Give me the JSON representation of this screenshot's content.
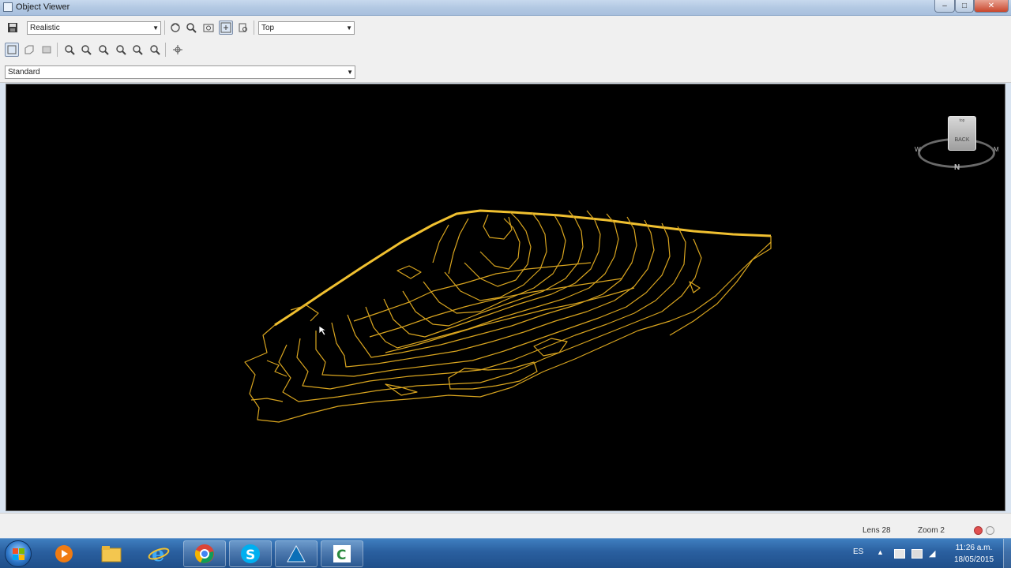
{
  "window": {
    "title": "Object Viewer"
  },
  "toolbar": {
    "visual_style": "Realistic",
    "view_direction": "Top",
    "display_style": "Standard",
    "icons_row1": [
      "save-icon",
      "orbit-icon",
      "zoom-icon",
      "zoom-window-icon",
      "pan-icon",
      "extents-icon"
    ],
    "icons_row2": [
      "view-top-icon",
      "view-iso-icon",
      "view-render-icon",
      "zoom-in-icon",
      "zoom-out-icon",
      "zoom-center-icon",
      "zoom-previous-icon",
      "zoom-all-icon",
      "zoom-extents-icon",
      "crosshair-icon"
    ]
  },
  "viewcube": {
    "face_label": "BACK",
    "top_label": "top",
    "north": "N",
    "west": "W",
    "east": "M"
  },
  "status": {
    "lens": "Lens 28",
    "zoom": "Zoom 2"
  },
  "taskbar": {
    "apps": [
      "media-player",
      "file-explorer",
      "internet-explorer",
      "chrome",
      "skype",
      "autocad",
      "civil3d"
    ],
    "language": "ES",
    "time": "11:26 a.m.",
    "date": "18/05/2015"
  },
  "colors": {
    "viewport_bg": "#000000",
    "contour": "#d9a51f"
  }
}
